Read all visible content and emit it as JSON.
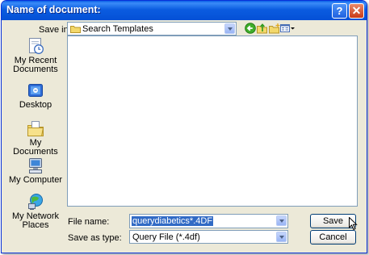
{
  "dialog": {
    "title": "Name of document:"
  },
  "titlebar": {
    "help_label": "?",
    "close_label": "✕"
  },
  "save_in": {
    "label": "Save in:",
    "value": "Search Templates"
  },
  "toolbar": [
    "back-icon",
    "up-folder-icon",
    "new-folder-icon",
    "views-menu-icon"
  ],
  "places": [
    {
      "label": "My Recent Documents",
      "icon": "recent-documents-icon"
    },
    {
      "label": "Desktop",
      "icon": "desktop-icon"
    },
    {
      "label": "My Documents",
      "icon": "my-documents-icon"
    },
    {
      "label": "My Computer",
      "icon": "my-computer-icon"
    },
    {
      "label": "My Network Places",
      "icon": "network-places-icon"
    }
  ],
  "file_name": {
    "label": "File name:",
    "value": "querydiabetics*.4DF"
  },
  "save_as_type": {
    "label": "Save as type:",
    "value": "Query File (*.4df)"
  },
  "buttons": {
    "save": "Save",
    "cancel": "Cancel"
  }
}
